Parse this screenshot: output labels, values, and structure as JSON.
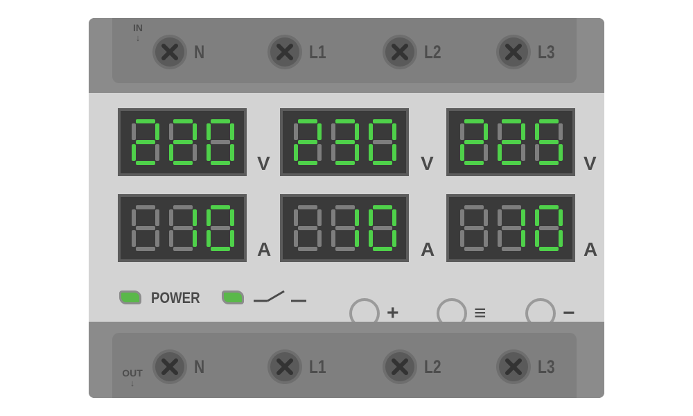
{
  "input_terminals": {
    "label": "IN",
    "arrow": "↓",
    "terminals": [
      {
        "label": "N"
      },
      {
        "label": "L1"
      },
      {
        "label": "L2"
      },
      {
        "label": "L3"
      }
    ]
  },
  "output_terminals": {
    "label": "OUT",
    "arrow": "↓",
    "terminals": [
      {
        "label": "N"
      },
      {
        "label": "L1"
      },
      {
        "label": "L2"
      },
      {
        "label": "L3"
      }
    ]
  },
  "displays": {
    "voltage_unit": "V",
    "current_unit": "A",
    "voltage_readings": [
      "220",
      "230",
      "225"
    ],
    "current_readings": [
      "10",
      "10",
      "10"
    ]
  },
  "indicators": {
    "power_label": "POWER",
    "power_led_color": "#5ab84a",
    "relay_led_color": "#5ab84a",
    "relay_icon": "relay-switch-icon"
  },
  "buttons": [
    {
      "glyph": "+",
      "icon": "plus-icon"
    },
    {
      "glyph": "≡",
      "icon": "menu-icon"
    },
    {
      "glyph": "−",
      "icon": "minus-icon"
    }
  ],
  "colors": {
    "segment_on": "#4fd14a",
    "segment_off": "#7e7e7e",
    "display_bg": "#3a3a3a"
  }
}
